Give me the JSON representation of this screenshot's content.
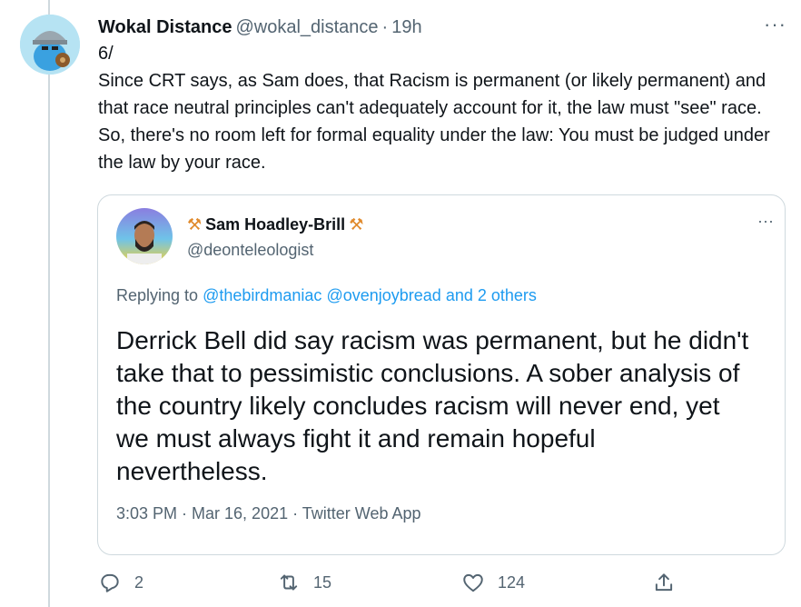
{
  "tweet": {
    "display_name": "Wokal Distance",
    "handle": "@wokal_distance",
    "separator": "·",
    "time": "19h",
    "more": "···",
    "text": "6/\nSince CRT says, as Sam does, that Racism is permanent (or likely permanent) and that race neutral principles can't adequately account for it, the law must \"see\" race. So, there's no room left for formal equality under the law: You must be judged under the law by your race."
  },
  "quote": {
    "display_name": "Sam Hoadley-Brill",
    "name_emoji": "⚒",
    "handle": "@deonteleologist",
    "more": "···",
    "replying_prefix": "Replying to",
    "reply_targets": [
      "@thebirdmaniac",
      "@ovenjoybread",
      "and 2 others"
    ],
    "text": "Derrick Bell did say racism was permanent, but he didn't take that to pessimistic conclusions. A sober analysis of the country likely concludes racism will never end, yet we must always fight it and remain hopeful nevertheless.",
    "meta": "3:03 PM · Mar 16, 2021 · Twitter Web App"
  },
  "actions": {
    "reply_count": "2",
    "retweet_count": "15",
    "like_count": "124"
  },
  "colors": {
    "link": "#1d9bf0",
    "muted": "#536471",
    "border": "#cfd9de",
    "hammer": "#e08a2c"
  },
  "icons": [
    "reply-icon",
    "retweet-icon",
    "like-icon",
    "share-icon"
  ]
}
